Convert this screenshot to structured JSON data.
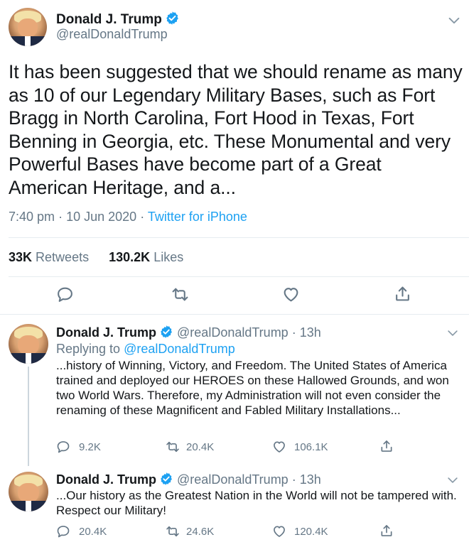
{
  "main_tweet": {
    "name": "Donald J. Trump",
    "handle": "@realDonaldTrump",
    "text": "It has been suggested that we should rename as many as 10 of our Legendary Military Bases, such as Fort Bragg in North Carolina, Fort Hood in Texas, Fort Benning in Georgia, etc. These Monumental and very Powerful Bases have become part of a Great American Heritage, and a...",
    "time": "7:40 pm",
    "date": "10 Jun 2020",
    "source": "Twitter for iPhone",
    "retweets_count": "33K",
    "retweets_label": "Retweets",
    "likes_count": "130.2K",
    "likes_label": "Likes"
  },
  "replies": [
    {
      "name": "Donald J. Trump",
      "handle": "@realDonaldTrump",
      "age": "13h",
      "replying_to_label": "Replying to",
      "replying_to_handle": "@realDonaldTrump",
      "text": "...history of Winning, Victory, and Freedom. The United States of America trained and deployed our HEROES on these Hallowed Grounds, and won two World Wars. Therefore, my Administration will not even consider the renaming of these Magnificent and Fabled Military Installations...",
      "replies_count": "9.2K",
      "retweets_count": "20.4K",
      "likes_count": "106.1K"
    },
    {
      "name": "Donald J. Trump",
      "handle": "@realDonaldTrump",
      "age": "13h",
      "text": "...Our history as the Greatest Nation in the World will not be tampered with. Respect our Military!",
      "replies_count": "20.4K",
      "retweets_count": "24.6K",
      "likes_count": "120.4K"
    }
  ],
  "separator": "·",
  "colors": {
    "text": "#14171a",
    "secondary": "#657786",
    "link": "#1da1f2",
    "verified": "#1da1f2",
    "divider": "#e6ecf0"
  },
  "icons": [
    "verified-badge-icon",
    "chevron-down-icon",
    "reply-icon",
    "retweet-icon",
    "like-icon",
    "share-icon"
  ]
}
